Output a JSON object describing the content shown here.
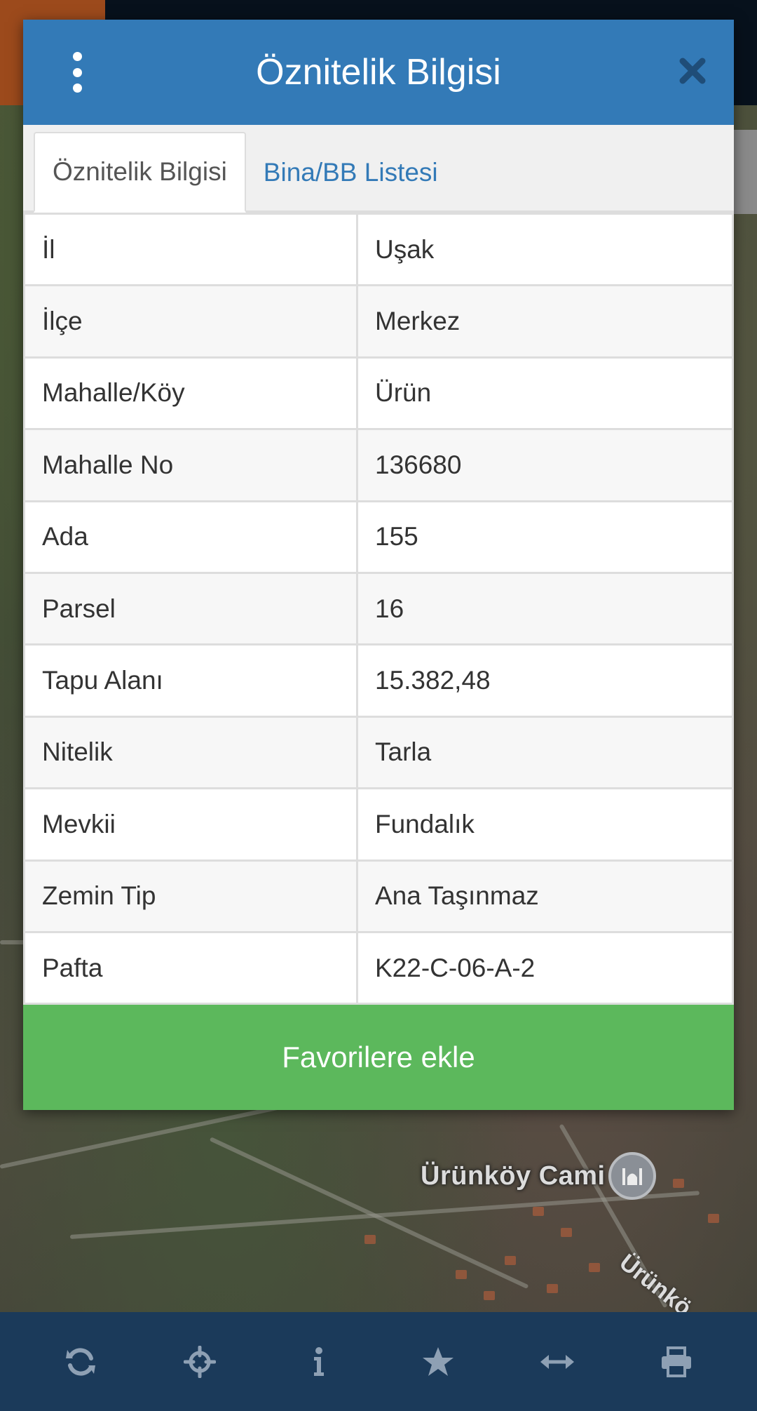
{
  "dialog": {
    "title": "Öznitelik Bilgisi",
    "menu_icon": "kebab-menu-icon",
    "close_icon": "close-icon",
    "tabs": [
      {
        "label": "Öznitelik Bilgisi",
        "active": true
      },
      {
        "label": "Bina/BB Listesi",
        "active": false
      }
    ],
    "rows": [
      {
        "key": "İl",
        "value": "Uşak"
      },
      {
        "key": "İlçe",
        "value": "Merkez"
      },
      {
        "key": "Mahalle/Köy",
        "value": "Ürün"
      },
      {
        "key": "Mahalle No",
        "value": "136680"
      },
      {
        "key": "Ada",
        "value": "155"
      },
      {
        "key": "Parsel",
        "value": "16"
      },
      {
        "key": "Tapu Alanı",
        "value": "15.382,48"
      },
      {
        "key": "Nitelik",
        "value": "Tarla"
      },
      {
        "key": "Mevkii",
        "value": "Fundalık"
      },
      {
        "key": "Zemin Tip",
        "value": "Ana Taşınmaz"
      },
      {
        "key": "Pafta",
        "value": "K22-C-06-A-2"
      }
    ],
    "favorite_button": "Favorilere ekle"
  },
  "map": {
    "poi_label": "Ürünköy Cami",
    "street_label": "Ürünkö"
  },
  "toolbar": {
    "icons": [
      "refresh-icon",
      "crosshair-icon",
      "info-icon",
      "star-icon",
      "measure-icon",
      "print-icon"
    ]
  },
  "colors": {
    "header": "#337ab7",
    "favorite_button": "#5cb85c",
    "toolbar": "#1b3a5a"
  }
}
